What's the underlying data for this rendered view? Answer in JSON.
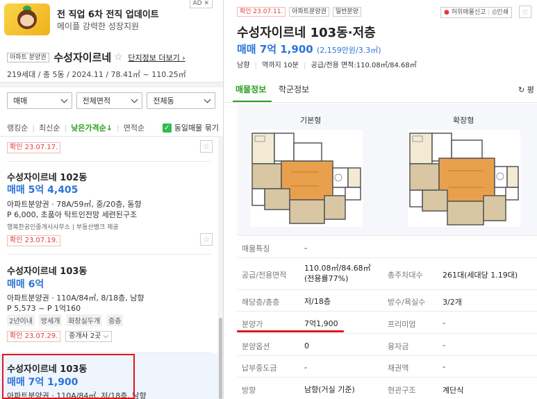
{
  "ad": {
    "title": "전 직업 6차 전직 업데이트",
    "subtitle": "메이플 강력한 성장지원",
    "tag": "AD ✕"
  },
  "complex": {
    "type_tag": "아파트 분양권",
    "name": "수성자이르네",
    "star": "☆",
    "link": "단지정보 더보기",
    "info": "219세대 / 총 5동 / 2024.11 / 78.41㎡ ~ 110.25㎡"
  },
  "filters": {
    "trade": "매매",
    "area": "전체면적",
    "dong": "전체동"
  },
  "sort": {
    "items": [
      "랭킹순",
      "최신순",
      "낮은가격순↓",
      "면적순"
    ],
    "same_listing": "동일매물 묶기"
  },
  "listings": [
    {
      "confirm": "확인 23.07.17."
    },
    {
      "name": "수성자이르네 102동",
      "price": "매매 5억 4,405",
      "desc": "아파트분양권 · 78A/59㎡, 중/20층, 동향",
      "desc2": "P 6,000, 초품아 탁트인전망 세련된구조",
      "meta": "행복한공인중개사사무소 | 부동산뱅크 제공",
      "confirm": "확인 23.07.19."
    },
    {
      "name": "수성자이르네 103동",
      "price": "매매 6억",
      "desc": "아파트분양권 · 110A/84㎡, 8/18층, 남향",
      "desc2": "P 5,573 ~ P 1억160",
      "chips": [
        "2년이내",
        "방세개",
        "화장실두개",
        "중층"
      ],
      "confirm": "확인 23.07.29.",
      "agent": "중개사 2곳"
    },
    {
      "name": "수성자이르네 103동",
      "price": "매매 7억 1,900",
      "desc": "아파트분양권 · 110A/84㎡, 저/18층, 남향"
    }
  ],
  "detail": {
    "badges": [
      "확인 23.07.11.",
      "아파트분양권",
      "일반분양"
    ],
    "report": "허위매물신고",
    "print": "인쇄",
    "bookmark": "☆",
    "title": "수성자이르네 103동·저층",
    "price": "매매 7억 1,900",
    "price_sub": "(2,159만원/3.3㎡)",
    "info": [
      "남향",
      "역까지 10분",
      "공급/전용 면적:110.08㎡/84.68㎡"
    ],
    "tabs": [
      "매물정보",
      "학군정보"
    ],
    "tab_right": "↻ 평",
    "plans": [
      "기본형",
      "확장형"
    ],
    "table": [
      {
        "k": "매물특징",
        "v": "-"
      },
      {
        "k": "공급/전용면적",
        "v": "110.08㎡/84.68㎡(전용률77%)",
        "k2": "총주차대수",
        "v2": "261대(세대당 1.19대)"
      },
      {
        "k": "해당층/총층",
        "v": "저/18층",
        "k2": "방수/욕실수",
        "v2": "3/2개"
      },
      {
        "k": "분양가",
        "v": "7억1,900",
        "k2": "프리미엄",
        "v2": "-"
      },
      {
        "k": "분양옵션",
        "v": "0",
        "k2": "융자금",
        "v2": "-"
      },
      {
        "k": "납부중도금",
        "v": "-",
        "k2": "채권액",
        "v2": "-"
      },
      {
        "k": "방향",
        "v": "남향(거실 기준)",
        "k2": "현관구조",
        "v2": "계단식"
      }
    ]
  },
  "colors": {
    "accent_green": "#2a9d1f",
    "price_blue": "#2d73d9",
    "confirm_red": "#e23b3b",
    "highlight_red": "#e2141c"
  }
}
